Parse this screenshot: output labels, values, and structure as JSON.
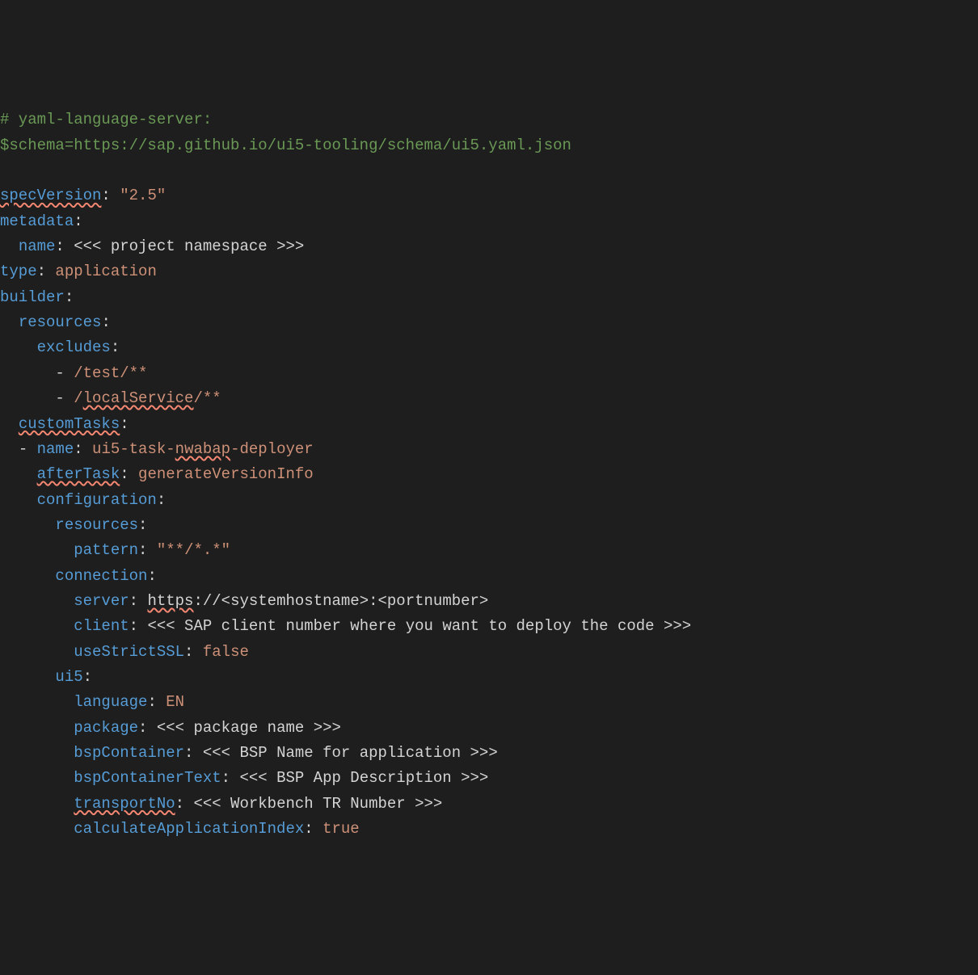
{
  "lines": {
    "l1_comment": "# yaml-language-server:",
    "l2_comment": "$schema=https://sap.github.io/ui5-tooling/schema/ui5.yaml.json",
    "l3_empty": " ",
    "l4_key": "specVersion",
    "l4_val": "\"2.5\"",
    "l5_key": "metadata",
    "l6_key": "name",
    "l6_val": "<<< project namespace >>>",
    "l7_key": "type",
    "l7_val": "application",
    "l8_key": "builder",
    "l9_key": "resources",
    "l10_key": "excludes",
    "l11_dash": "-",
    "l11_val": "/test/**",
    "l12_dash": "-",
    "l12_val_a": "/",
    "l12_val_b": "localService",
    "l12_val_c": "/**",
    "l13_key": "customTasks",
    "l14_dash": "-",
    "l14_key": "name",
    "l14_val_a": "ui5-task-",
    "l14_val_b": "nwabap",
    "l14_val_c": "-deployer",
    "l15_key": "afterTask",
    "l15_val": "generateVersionInfo",
    "l16_key": "configuration",
    "l17_key": "resources",
    "l18_key": "pattern",
    "l18_val": "\"**/*.*\"",
    "l19_key": "connection",
    "l20_key": "server",
    "l20_val_a": "https",
    "l20_val_b": "://<systemhostname>:<portnumber>",
    "l21_key": "client",
    "l21_val": "<<< SAP client number where you want to deploy the code >>>",
    "l22_key": "useStrictSSL",
    "l22_val": "false",
    "l23_key": "ui5",
    "l24_key": "language",
    "l24_val": "EN",
    "l25_key": "package",
    "l25_val": "<<< package name >>>",
    "l26_key": "bspContainer",
    "l26_val": "<<< BSP Name for application >>>",
    "l27_key": "bspContainerText",
    "l27_val": "<<< BSP App Description >>>",
    "l28_key": "transportNo",
    "l28_val": "<<< Workbench TR Number >>>",
    "l29_key": "calculateApplicationIndex",
    "l29_val": "true"
  }
}
